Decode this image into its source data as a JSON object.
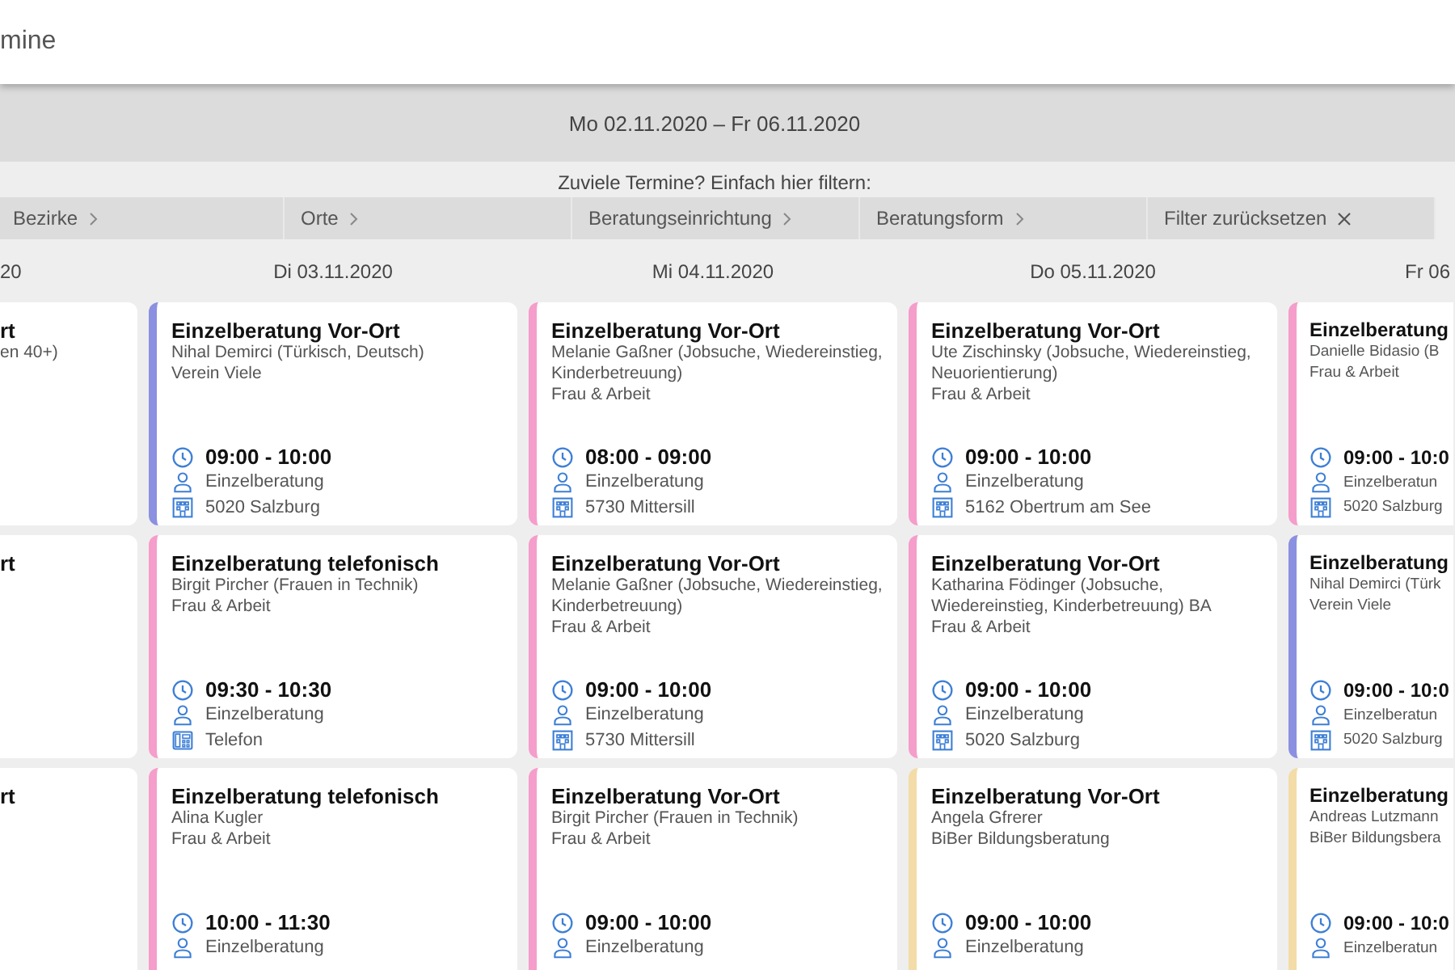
{
  "header": {
    "title": "mine"
  },
  "week": {
    "range": "Mo 02.11.2020 – Fr 06.11.2020"
  },
  "filter": {
    "prompt": "Zuviele Termine? Einfach hier filtern:",
    "items": [
      {
        "label": "Bezirke",
        "kind": "menu"
      },
      {
        "label": "Orte",
        "kind": "menu"
      },
      {
        "label": "Beratungseinrichtung",
        "kind": "menu"
      },
      {
        "label": "Beratungsform",
        "kind": "menu"
      },
      {
        "label": "Filter zurücksetzen",
        "kind": "reset"
      }
    ]
  },
  "days": [
    {
      "header": "20",
      "appointments": [
        {
          "title": "rt",
          "person": "en 40+)"
        },
        {
          "title": "rt"
        },
        {
          "title": "rt"
        }
      ]
    },
    {
      "header": "Di 03.11.2020",
      "appointments": [
        {
          "title": "Einzelberatung Vor-Ort",
          "person": "Nihal Demirci (Türkisch, Deutsch)",
          "org": "Verein Viele",
          "color": "#8b90e0",
          "time": "09:00 - 10:00",
          "type": "Einzelberatung",
          "location": "5020 Salzburg",
          "kind": "building"
        },
        {
          "title": "Einzelberatung telefonisch",
          "person": "Birgit Pircher (Frauen in Technik)",
          "org": "Frau & Arbeit",
          "color": "#f59dcb",
          "time": "09:30 - 10:30",
          "type": "Einzelberatung",
          "location": "Telefon",
          "kind": "phone"
        },
        {
          "title": "Einzelberatung telefonisch",
          "person": "Alina Kugler",
          "org": "Frau & Arbeit",
          "color": "#f59dcb",
          "time": "10:00 - 11:30",
          "type": "Einzelberatung"
        }
      ]
    },
    {
      "header": "Mi 04.11.2020",
      "appointments": [
        {
          "title": "Einzelberatung Vor-Ort",
          "person": "Melanie Gaßner (Jobsuche, Wiedereinstieg, Kinderbetreuung)",
          "org": "Frau & Arbeit",
          "color": "#f59dcb",
          "time": "08:00 - 09:00",
          "type": "Einzelberatung",
          "location": "5730 Mittersill",
          "kind": "building"
        },
        {
          "title": "Einzelberatung Vor-Ort",
          "person": "Melanie Gaßner (Jobsuche, Wiedereinstieg, Kinderbetreuung)",
          "org": "Frau & Arbeit",
          "color": "#f59dcb",
          "time": "09:00 - 10:00",
          "type": "Einzelberatung",
          "location": "5730 Mittersill",
          "kind": "building"
        },
        {
          "title": "Einzelberatung Vor-Ort",
          "person": "Birgit Pircher (Frauen in Technik)",
          "org": "Frau & Arbeit",
          "color": "#f59dcb",
          "time": "09:00 - 10:00",
          "type": "Einzelberatung"
        }
      ]
    },
    {
      "header": "Do 05.11.2020",
      "appointments": [
        {
          "title": "Einzelberatung Vor-Ort",
          "person": "Ute Zischinsky (Jobsuche, Wiedereinstieg, Neuorientierung)",
          "org": "Frau & Arbeit",
          "color": "#f59dcb",
          "time": "09:00 - 10:00",
          "type": "Einzelberatung",
          "location": "5162 Obertrum am See",
          "kind": "building"
        },
        {
          "title": "Einzelberatung Vor-Ort",
          "person": "Katharina Födinger (Jobsuche, Wiedereinstieg, Kinderbetreuung) BA",
          "org": "Frau & Arbeit",
          "color": "#f59dcb",
          "time": "09:00 - 10:00",
          "type": "Einzelberatung",
          "location": "5020 Salzburg",
          "kind": "building"
        },
        {
          "title": "Einzelberatung Vor-Ort",
          "person": "Angela Gfrerer",
          "org": "BiBer Bildungsberatung",
          "color": "#f3dca8",
          "time": "09:00 - 10:00",
          "type": "Einzelberatung"
        }
      ]
    },
    {
      "header": "Fr 06",
      "appointments": [
        {
          "title": "Einzelberatung",
          "person": "Danielle Bidasio (B",
          "org": "Frau & Arbeit",
          "color": "#f59dcb",
          "time": "09:00 - 10:0",
          "type": "Einzelberatun",
          "location": "5020 Salzburg",
          "kind": "building"
        },
        {
          "title": "Einzelberatung",
          "person": "Nihal Demirci (Türk",
          "org": "Verein Viele",
          "color": "#8b90e0",
          "time": "09:00 - 10:0",
          "type": "Einzelberatun",
          "location": "5020 Salzburg",
          "kind": "building"
        },
        {
          "title": "Einzelberatung",
          "person": "Andreas Lutzmann",
          "org": "BiBer Bildungsbera",
          "color": "#f3dca8",
          "time": "09:00 - 10:0",
          "type": "Einzelberatun"
        }
      ]
    }
  ]
}
